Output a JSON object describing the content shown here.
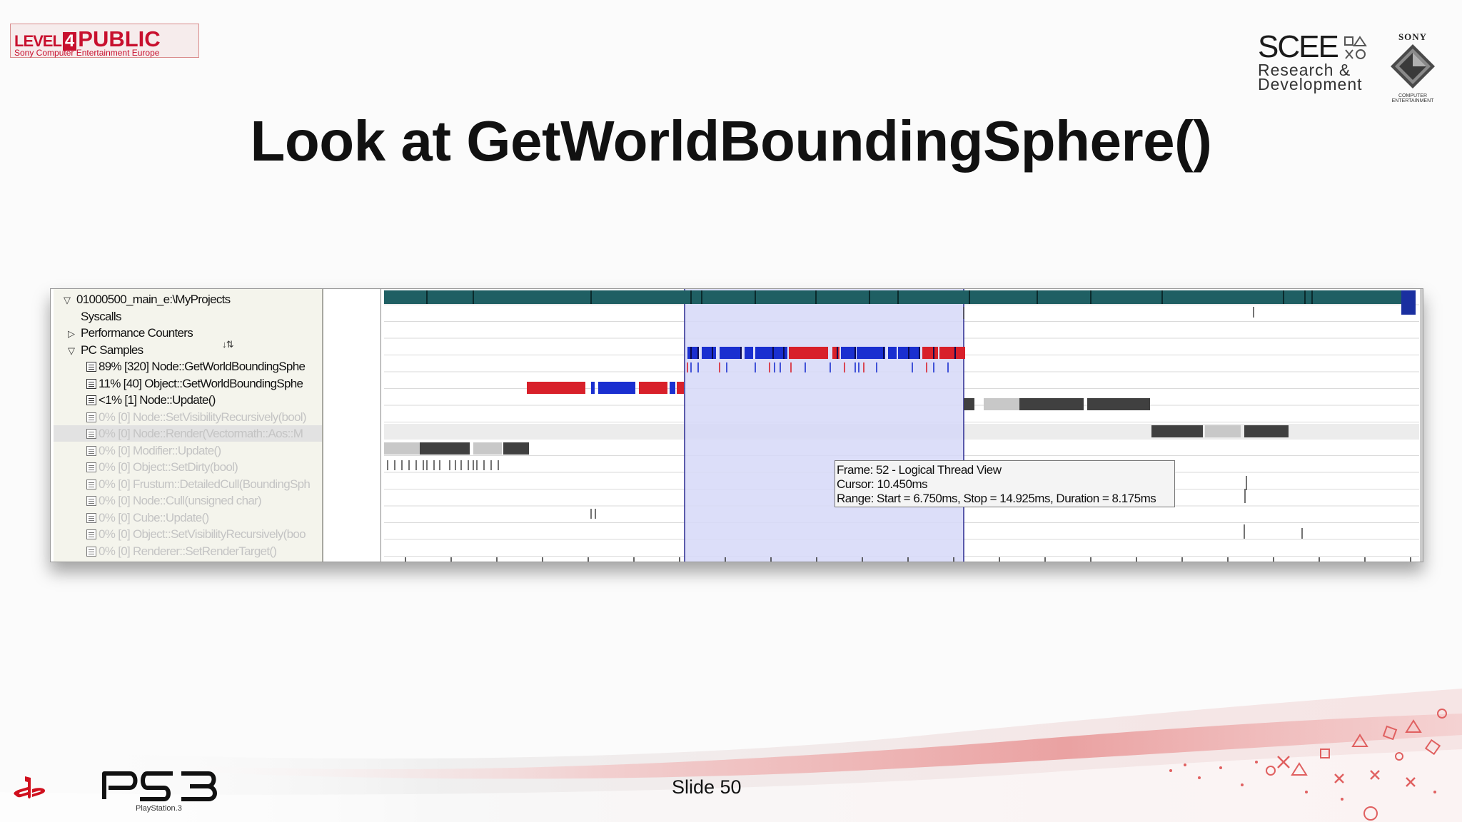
{
  "header": {
    "badge": {
      "level_text": "LEVEL",
      "level_number": "4",
      "public_text": "PUBLIC",
      "subtitle": "Sony Computer Entertainment Europe"
    },
    "sce_logo": {
      "name": "SCEE",
      "line1": "Research &",
      "line2": "Development"
    },
    "sony_logo": {
      "label": "SONY",
      "caption": "COMPUTER ENTERTAINMENT"
    }
  },
  "slide": {
    "title": "Look at GetWorldBoundingSphere()",
    "number_label": "Slide 50"
  },
  "profiler": {
    "tree": [
      {
        "label": "01000500_main_e:\\MyProjects",
        "indent": 0,
        "expander": "expanded",
        "dim": false
      },
      {
        "label": "Syscalls",
        "indent": 1,
        "expander": "none",
        "dim": false
      },
      {
        "label": "Performance Counters",
        "indent": 1,
        "expander": "collapsed",
        "dim": false
      },
      {
        "label": "PC Samples",
        "indent": 1,
        "expander": "expanded",
        "dim": false
      },
      {
        "label": "89% [320] Node::GetWorldBoundingSphe",
        "indent": 2,
        "doc": true,
        "dim": false
      },
      {
        "label": "11% [40] Object::GetWorldBoundingSphe",
        "indent": 2,
        "doc": true,
        "dim": false
      },
      {
        "label": "<1% [1] Node::Update()",
        "indent": 2,
        "doc": true,
        "dim": false
      },
      {
        "label": "0% [0] Node::SetVisibilityRecursively(bool)",
        "indent": 2,
        "doc": true,
        "dim": true
      },
      {
        "label": "0% [0] Node::Render(Vectormath::Aos::M",
        "indent": 2,
        "doc": true,
        "dim": true,
        "selected": true
      },
      {
        "label": "0% [0] Modifier::Update()",
        "indent": 2,
        "doc": true,
        "dim": true
      },
      {
        "label": "0% [0] Object::SetDirty(bool)",
        "indent": 2,
        "doc": true,
        "dim": true
      },
      {
        "label": "0% [0] Frustum::DetailedCull(BoundingSph",
        "indent": 2,
        "doc": true,
        "dim": true
      },
      {
        "label": "0% [0] Node::Cull(unsigned char)",
        "indent": 2,
        "doc": true,
        "dim": true
      },
      {
        "label": "0% [0] Cube::Update()",
        "indent": 2,
        "doc": true,
        "dim": true
      },
      {
        "label": "0% [0] Object::SetVisibilityRecursively(boo",
        "indent": 2,
        "doc": true,
        "dim": true
      },
      {
        "label": "0% [0] Renderer::SetRenderTarget()",
        "indent": 2,
        "doc": true,
        "dim": true
      }
    ],
    "tooltip": {
      "line1": "Frame: 52 - Logical Thread View",
      "line2": "Cursor: 10.450ms",
      "line3": "Range: Start = 6.750ms, Stop = 14.925ms, Duration = 8.175ms"
    },
    "colors": {
      "frame_bar": "#1f5f63",
      "selection": "#d6d8f8",
      "red": "#d8202a",
      "blue": "#1a2fd0",
      "gray_dark": "#404040",
      "gray_light": "#c8c8c8"
    }
  },
  "footer": {
    "platform": "PS3",
    "platform_caption": "PlayStation.3"
  }
}
